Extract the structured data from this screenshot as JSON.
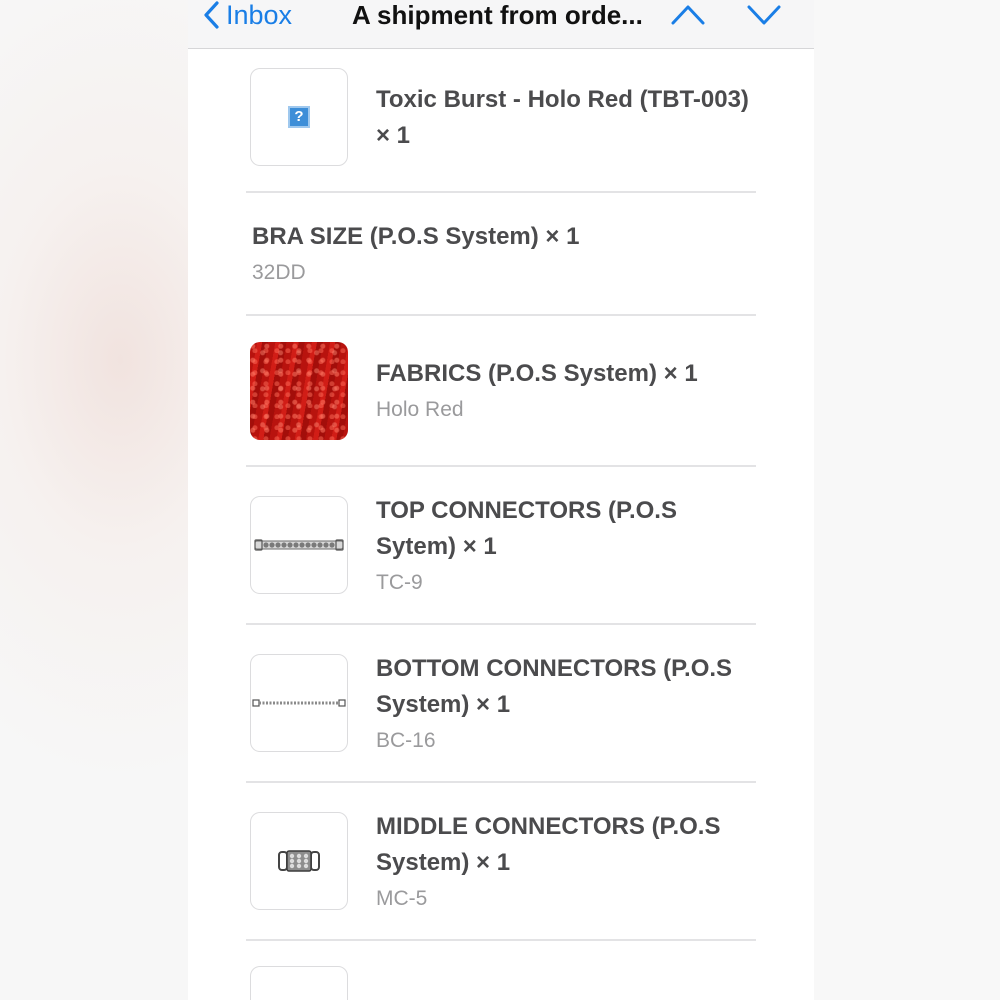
{
  "navbar": {
    "back_label": "Inbox",
    "title": "A shipment from orde...",
    "prev_icon": "chevron-up-icon",
    "next_icon": "chevron-down-icon",
    "accent_color": "#1a7ee6"
  },
  "items": [
    {
      "title": "Toxic Burst - Holo Red (TBT-003) × 1",
      "subtitle": "",
      "thumbnail": "broken-image-icon"
    },
    {
      "title": "BRA SIZE (P.O.S System) × 1",
      "subtitle": "32DD",
      "thumbnail": ""
    },
    {
      "title": "FABRICS (P.O.S System) × 1",
      "subtitle": "Holo Red",
      "thumbnail": "red-holo-fabric-image"
    },
    {
      "title": "TOP CONNECTORS (P.O.S Sytem) × 1",
      "subtitle": "TC-9",
      "thumbnail": "rhinestone-connector-image"
    },
    {
      "title": "BOTTOM CONNECTORS (P.O.S System) × 1",
      "subtitle": "BC-16",
      "thumbnail": "chain-connector-image"
    },
    {
      "title": "MIDDLE CONNECTORS (P.O.S System) × 1",
      "subtitle": "MC-5",
      "thumbnail": "jeweled-clasp-image"
    }
  ]
}
